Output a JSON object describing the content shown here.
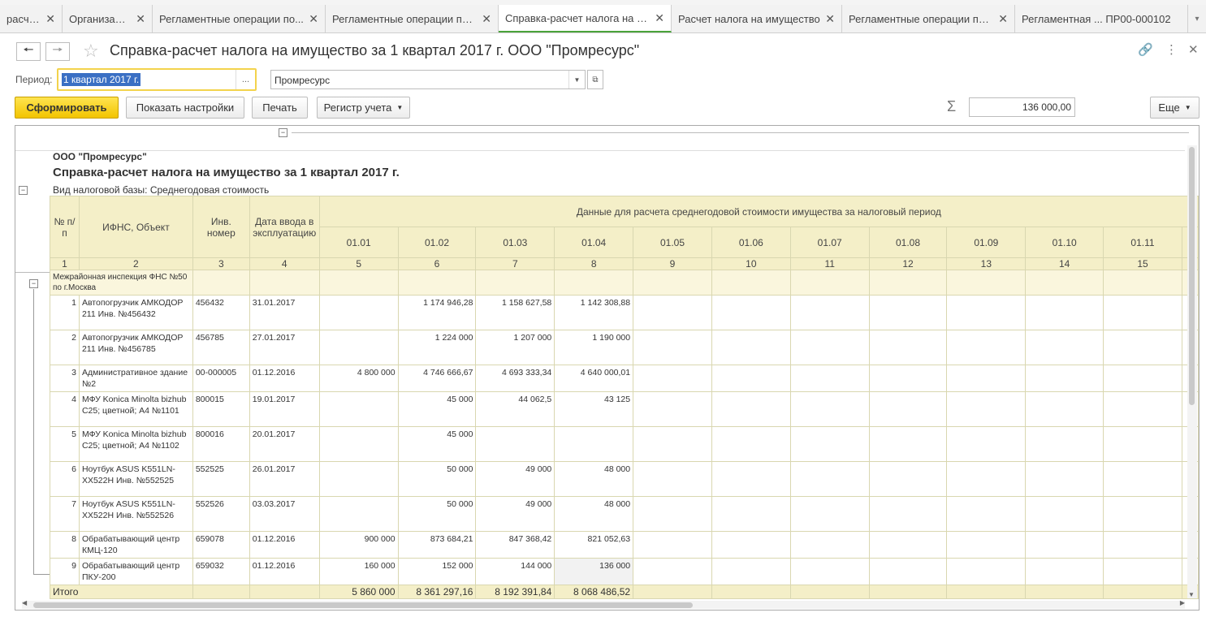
{
  "tabs": [
    {
      "label": "расчеты",
      "w": 77
    },
    {
      "label": "Организации",
      "w": 111
    },
    {
      "label": "Регламентные операции по...",
      "w": 213
    },
    {
      "label": "Регламентные операции по ...",
      "w": 213
    },
    {
      "label": "Справка-расчет налога на и...",
      "w": 213,
      "active": true
    },
    {
      "label": "Расчет налога на имущество",
      "w": 210
    },
    {
      "label": "Регламентные операции по ...",
      "w": 213
    },
    {
      "label": "Регламентная ... ПР00-000102",
      "w": 213
    }
  ],
  "form": {
    "title": "Справка-расчет налога на имущество  за 1 квартал 2017 г. ООО \"Промресурс\"",
    "period_label": "Период:",
    "period_value": "1 квартал 2017 г.",
    "period_dots": "...",
    "org_value": "Промресурс"
  },
  "toolbar": {
    "generate": "Сформировать",
    "show_settings": "Показать настройки",
    "print": "Печать",
    "register": "Регистр учета",
    "sum": "136 000,00",
    "more": "Еще"
  },
  "report": {
    "org": "ООО \"Промресурс\"",
    "title": "Справка-расчет налога на имущество  за 1 квартал 2017 г.",
    "base": "Вид налоговой базы:  Среднегодовая стоимость",
    "headers": {
      "num": "№ п/п",
      "ifns": "ИФНС, Объект",
      "inv": "Инв. номер",
      "date": "Дата ввода в эксплуатацию",
      "group": "Данные для расчета среднегодовой стоимости имущества за налоговый период",
      "months": [
        "01.01",
        "01.02",
        "01.03",
        "01.04",
        "01.05",
        "01.06",
        "01.07",
        "01.08",
        "01.09",
        "01.10",
        "01.11",
        ""
      ]
    },
    "col_numbers": [
      "1",
      "2",
      "3",
      "4",
      "5",
      "6",
      "7",
      "8",
      "9",
      "10",
      "11",
      "12",
      "13",
      "14",
      "15",
      ""
    ],
    "group_name": "Межрайонная инспекция ФНС №50 по г.Москва",
    "rows": [
      {
        "n": "1",
        "obj": "Автопогрузчик АМКОДОР 211 Инв. №456432",
        "inv": "456432",
        "date": "31.01.2017",
        "v": [
          "",
          "1 174 946,28",
          "1 158 627,58",
          "1 142 308,88"
        ]
      },
      {
        "n": "2",
        "obj": "Автопогрузчик АМКОДОР 211 Инв. №456785",
        "inv": "456785",
        "date": "27.01.2017",
        "v": [
          "",
          "1 224 000",
          "1 207 000",
          "1 190 000"
        ]
      },
      {
        "n": "3",
        "obj": "Административное здание №2",
        "inv": "00-000005",
        "date": "01.12.2016",
        "v": [
          "4 800 000",
          "4 746 666,67",
          "4 693 333,34",
          "4 640 000,01"
        ]
      },
      {
        "n": "4",
        "obj": "МФУ Konica Minolta bizhub C25; цветной; А4  №1101",
        "inv": "800015",
        "date": "19.01.2017",
        "v": [
          "",
          "45 000",
          "44 062,5",
          "43 125"
        ]
      },
      {
        "n": "5",
        "obj": "МФУ Konica Minolta bizhub C25; цветной; А4  №1102",
        "inv": "800016",
        "date": "20.01.2017",
        "v": [
          "",
          "45 000",
          "",
          ""
        ]
      },
      {
        "n": "6",
        "obj": "Ноутбук ASUS K551LN-XX522H Инв. №552525",
        "inv": "552525",
        "date": "26.01.2017",
        "v": [
          "",
          "50 000",
          "49 000",
          "48 000"
        ]
      },
      {
        "n": "7",
        "obj": "Ноутбук ASUS K551LN-XX522H Инв. №552526",
        "inv": "552526",
        "date": "03.03.2017",
        "v": [
          "",
          "50 000",
          "49 000",
          "48 000"
        ]
      },
      {
        "n": "8",
        "obj": "Обрабатывающий центр КМЦ-120",
        "inv": "659078",
        "date": "01.12.2016",
        "v": [
          "900 000",
          "873 684,21",
          "847 368,42",
          "821 052,63"
        ]
      },
      {
        "n": "9",
        "obj": "Обрабатывающий центр ПКУ-200",
        "inv": "659032",
        "date": "01.12.2016",
        "v": [
          "160 000",
          "152 000",
          "144 000",
          "136 000"
        ]
      }
    ],
    "total_label": "Итого",
    "totals": [
      "5 860 000",
      "8 361 297,16",
      "8 192 391,84",
      "8 068 486,52"
    ]
  }
}
